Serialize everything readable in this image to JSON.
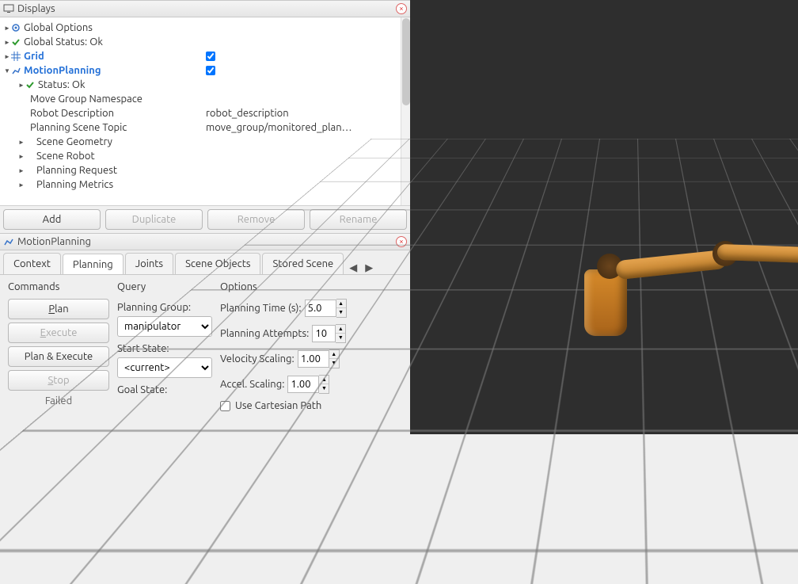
{
  "displays_panel": {
    "title": "Displays",
    "tree": {
      "global_options": "Global Options",
      "global_status": "Global Status: Ok",
      "grid": "Grid",
      "grid_checked": true,
      "motion_planning": "MotionPlanning",
      "motion_planning_checked": true,
      "mp_children": {
        "status": "Status: Ok",
        "move_group_ns": "Move Group Namespace",
        "robot_desc_label": "Robot Description",
        "robot_desc_val": "robot_description",
        "planning_topic_label": "Planning Scene Topic",
        "planning_topic_val": "move_group/monitored_plan…",
        "scene_geometry": "Scene Geometry",
        "scene_robot": "Scene Robot",
        "planning_request": "Planning Request",
        "planning_metrics": "Planning Metrics"
      }
    },
    "buttons": {
      "add": "Add",
      "duplicate": "Duplicate",
      "remove": "Remove",
      "rename": "Rename"
    }
  },
  "mp_panel": {
    "title": "MotionPlanning",
    "tabs": [
      "Context",
      "Planning",
      "Joints",
      "Scene Objects",
      "Stored Scene"
    ],
    "active_tab": 1,
    "commands": {
      "heading": "Commands",
      "plan": "Plan",
      "execute": "Execute",
      "plan_execute": "Plan & Execute",
      "stop": "Stop",
      "failed": "Failed"
    },
    "query": {
      "heading": "Query",
      "planning_group_label": "Planning Group:",
      "planning_group_value": "manipulator",
      "start_state_label": "Start State:",
      "start_state_value": "<current>",
      "goal_state_label": "Goal State:"
    },
    "options": {
      "heading": "Options",
      "planning_time_label": "Planning Time (s):",
      "planning_time_value": "5.0",
      "planning_attempts_label": "Planning Attempts:",
      "planning_attempts_value": "10",
      "velocity_label": "Velocity Scaling:",
      "velocity_value": "1.00",
      "accel_label": "Accel. Scaling:",
      "accel_value": "1.00",
      "cartesian_label": "Use Cartesian Path"
    }
  }
}
